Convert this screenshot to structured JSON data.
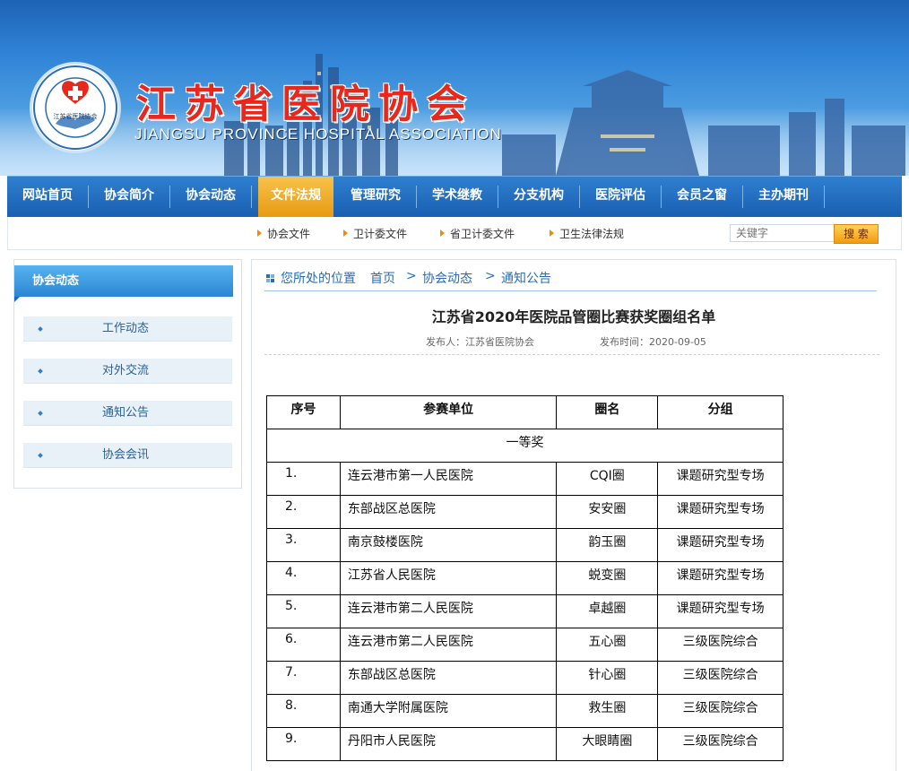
{
  "header": {
    "title": "江苏省医院协会",
    "subtitle": "JIANGSU PROVINCE HOSPITAL ASSOCIATION",
    "logo_ring_text": "JIANGSU PROVINCE HOSPITAL ASSOCIATION",
    "logo_center_text": "江苏省医院协会"
  },
  "nav": {
    "items": [
      "网站首页",
      "协会简介",
      "协会动态",
      "文件法规",
      "管理研究",
      "学术继教",
      "分支机构",
      "医院评估",
      "会员之窗",
      "主办期刊"
    ],
    "active_index": 3
  },
  "subnav": {
    "items": [
      "协会文件",
      "卫计委文件",
      "省卫计委文件",
      "卫生法律法规"
    ]
  },
  "search": {
    "placeholder": "关键字",
    "button": "搜 索"
  },
  "sidebar": {
    "heading": "协会动态",
    "items": [
      "工作动态",
      "对外交流",
      "通知公告",
      "协会会讯"
    ]
  },
  "breadcrumb": {
    "prefix": "您所处的位置",
    "items": [
      "首页",
      "协会动态",
      "通知公告"
    ],
    "separator": ">"
  },
  "article": {
    "title": "江苏省2020年医院品管圈比赛获奖圈组名单",
    "publisher_label": "发布人：",
    "publisher": "江苏省医院协会",
    "date_label": "发布时间：",
    "date": "2020-09-05"
  },
  "table": {
    "headers": [
      "序号",
      "参赛单位",
      "圈名",
      "分组"
    ],
    "section": "一等奖",
    "rows": [
      [
        "1.",
        "连云港市第一人民医院",
        "CQI圈",
        "课题研究型专场"
      ],
      [
        "2.",
        "东部战区总医院",
        "安安圈",
        "课题研究型专场"
      ],
      [
        "3.",
        "南京鼓楼医院",
        "韵玉圈",
        "课题研究型专场"
      ],
      [
        "4.",
        "江苏省人民医院",
        "蜕变圈",
        "课题研究型专场"
      ],
      [
        "5.",
        "连云港市第二人民医院",
        "卓越圈",
        "课题研究型专场"
      ],
      [
        "6.",
        "连云港市第二人民医院",
        "五心圈",
        "三级医院综合"
      ],
      [
        "7.",
        "东部战区总医院",
        "针心圈",
        "三级医院综合"
      ],
      [
        "8.",
        "南通大学附属医院",
        "救生圈",
        "三级医院综合"
      ],
      [
        "9.",
        "丹阳市人民医院",
        "大眼睛圈",
        "三级医院综合"
      ]
    ]
  },
  "colors": {
    "nav_blue": "#1a5fb0",
    "nav_active": "#e89a12",
    "title_red": "#e8281c",
    "link_blue": "#2a6db5"
  }
}
